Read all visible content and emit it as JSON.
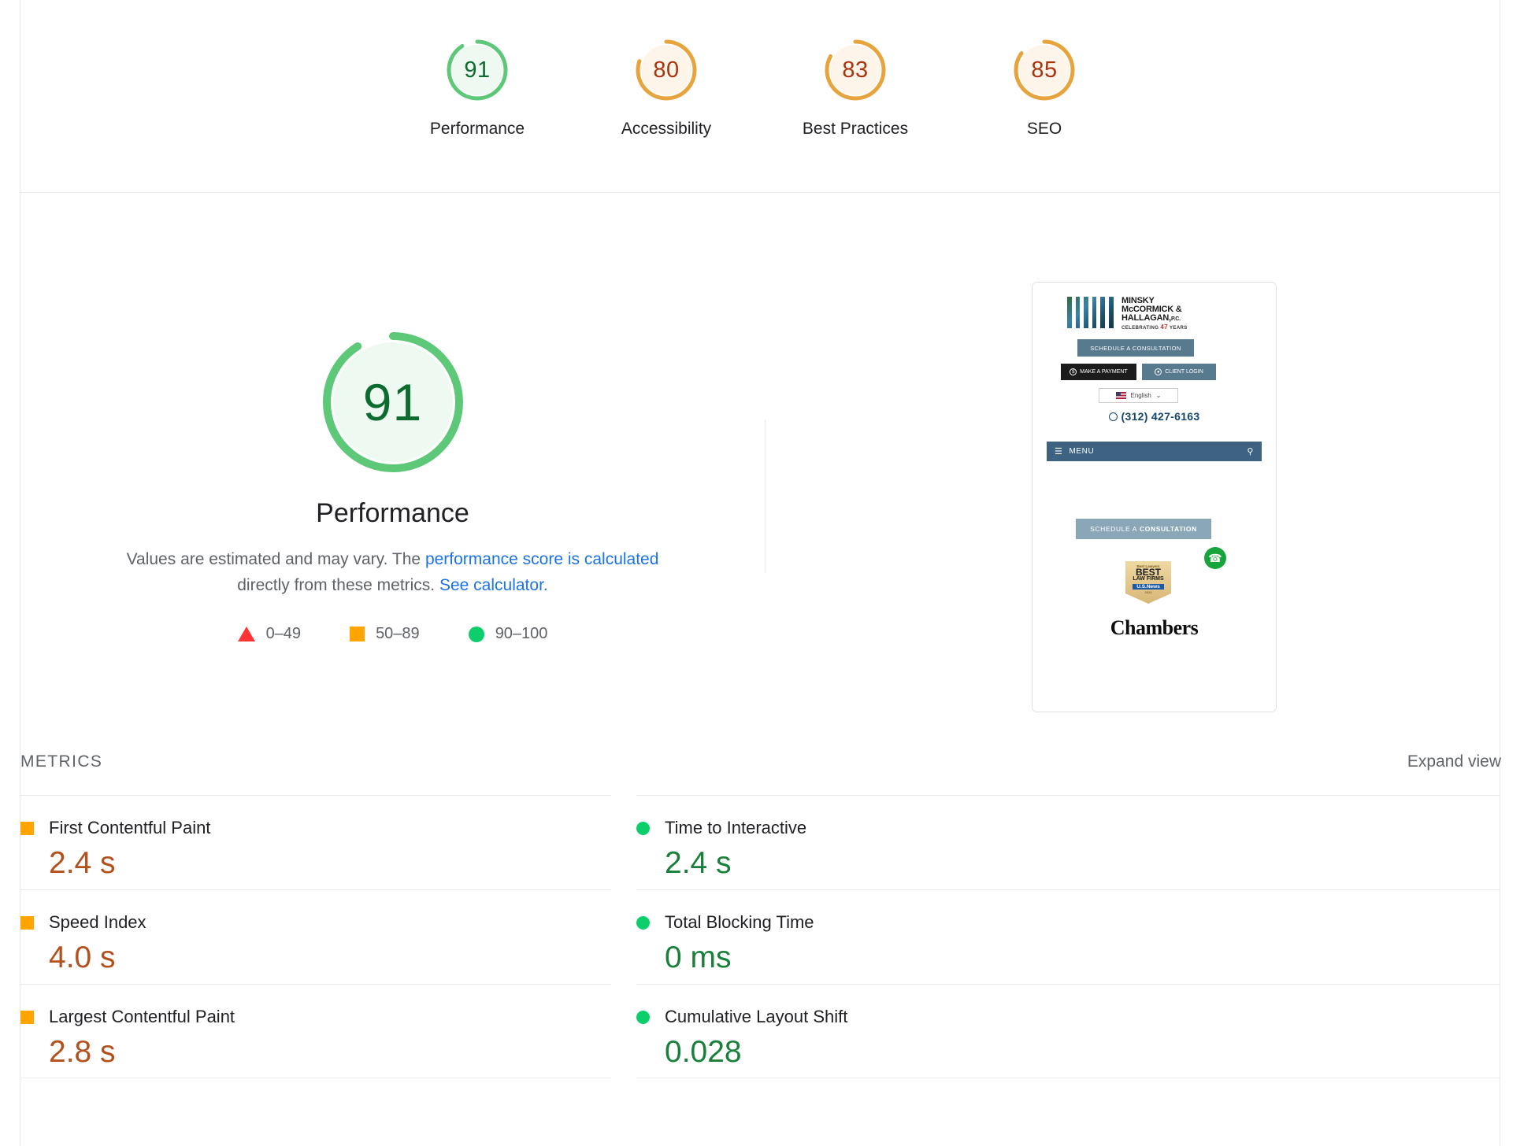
{
  "colors": {
    "green": "#0cce6b",
    "green_dark": "#0c6b2e",
    "green_fill": "#eef9f1",
    "orange": "#e8a33d",
    "orange_fill": "#fdf5ea",
    "orange_text": "#a8350e",
    "red": "#ff3333",
    "link": "#1a73e8",
    "value_orange": "#b3501b",
    "value_green": "#18803a"
  },
  "gauges": [
    {
      "score": 91,
      "label": "Performance",
      "tone": "green"
    },
    {
      "score": 80,
      "label": "Accessibility",
      "tone": "orange"
    },
    {
      "score": 83,
      "label": "Best Practices",
      "tone": "orange"
    },
    {
      "score": 85,
      "label": "SEO",
      "tone": "orange"
    }
  ],
  "performance": {
    "score": 91,
    "title": "Performance",
    "desc_lead": "Values are estimated and may vary. The ",
    "desc_link1": "performance score is calculated",
    "desc_mid": " directly from these metrics. ",
    "desc_link2": "See calculator.",
    "legend": [
      {
        "icon": "triangle-icon",
        "range": "0–49"
      },
      {
        "icon": "square-icon",
        "range": "50–89"
      },
      {
        "icon": "circle-icon",
        "range": "90–100"
      }
    ]
  },
  "thumbnail": {
    "logo_line1": "MINSKY",
    "logo_line2": "McCORMICK &",
    "logo_line3": "HALLAGAN,",
    "logo_line3_suffix": "P.C.",
    "logo_tagline_pre": "CELEBRATING ",
    "logo_tagline_num": "47",
    "logo_tagline_post": " YEARS",
    "btn_consultation": "SCHEDULE A CONSULTATION",
    "btn_payment": "MAKE A PAYMENT",
    "btn_login": "CLIENT LOGIN",
    "language": "English",
    "phone": "(312) 427-6163",
    "menu_label": "MENU",
    "cta_pre": "SCHEDULE A ",
    "cta_bold": "CONSULTATION",
    "badge_line1": "Best Lawyers",
    "badge_line2": "BEST",
    "badge_line3": "LAW FIRMS",
    "badge_line4": "U.S.News",
    "badge_line5": "2023",
    "chambers": "Chambers"
  },
  "metrics": {
    "section_title": "METRICS",
    "expand_view": "Expand view",
    "left": [
      {
        "name": "First Contentful Paint",
        "value": "2.4 s",
        "tone": "orange"
      },
      {
        "name": "Speed Index",
        "value": "4.0 s",
        "tone": "orange"
      },
      {
        "name": "Largest Contentful Paint",
        "value": "2.8 s",
        "tone": "orange"
      }
    ],
    "right": [
      {
        "name": "Time to Interactive",
        "value": "2.4 s",
        "tone": "green"
      },
      {
        "name": "Total Blocking Time",
        "value": "0 ms",
        "tone": "green"
      },
      {
        "name": "Cumulative Layout Shift",
        "value": "0.028",
        "tone": "green"
      }
    ]
  }
}
